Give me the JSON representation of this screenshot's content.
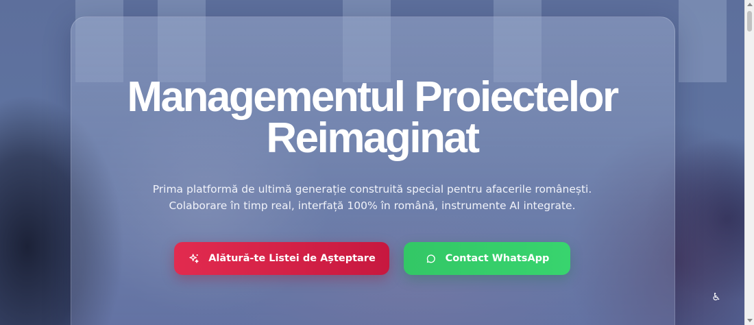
{
  "hero": {
    "title_line1": "Managementul Proiectelor",
    "title_line2": "Reimaginat",
    "subtitle_line1": "Prima platformă de ultimă generație construită special pentru afacerile românești.",
    "subtitle_line2": "Colaborare în timp real, interfață 100% în română, instrumente AI integrate."
  },
  "actions": {
    "waitlist_label": "Alătură-te Listei de Așteptare",
    "waitlist_icon": "sparkles-icon",
    "whatsapp_label": "Contact WhatsApp",
    "whatsapp_icon": "whatsapp-icon"
  },
  "accessibility": {
    "icon": "accessibility-icon",
    "glyph": "♿"
  },
  "colors": {
    "waitlist_button": "#d91f46",
    "whatsapp_button": "#36cf6b",
    "card_overlay": "#8c9bc4"
  }
}
